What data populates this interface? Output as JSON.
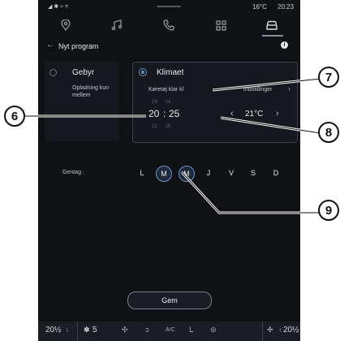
{
  "status_bar": {
    "temperature": "16°C",
    "time": "20:23"
  },
  "nav_tabs": [
    {
      "name": "location",
      "icon": "location-pin-icon"
    },
    {
      "name": "music",
      "icon": "music-note-icon"
    },
    {
      "name": "phone",
      "icon": "phone-icon"
    },
    {
      "name": "apps",
      "icon": "grid-icon"
    },
    {
      "name": "vehicle",
      "icon": "car-icon"
    }
  ],
  "header": {
    "title": "Nyt program"
  },
  "left_panel": {
    "option_label": "Gebyr",
    "description": "Opladning kun mellem"
  },
  "right_panel": {
    "option_label": "Klimaet",
    "ready_label": "Køretøj klar kl",
    "settings_label": "Indstillinger",
    "time_prev": "19      24",
    "time_hour": "20",
    "time_sep": ":",
    "time_minute": "25",
    "time_next": "21      26",
    "temperature": "21°C"
  },
  "repeat": {
    "label": "Gentag :",
    "days": [
      {
        "letter": "L",
        "selected": false
      },
      {
        "letter": "M",
        "selected": true
      },
      {
        "letter": "M",
        "selected": true
      },
      {
        "letter": "J",
        "selected": false
      },
      {
        "letter": "V",
        "selected": false
      },
      {
        "letter": "S",
        "selected": false
      },
      {
        "letter": "D",
        "selected": false
      }
    ]
  },
  "save_button": {
    "label": "Gem"
  },
  "bottom_bar": {
    "left_temp": "20½",
    "fan_level": "5",
    "ac_label": "A/C",
    "right_temp": "20½"
  },
  "callouts": [
    "6",
    "7",
    "8",
    "9"
  ],
  "colors": {
    "accent": "#6b93c9",
    "background": "#0f1114"
  }
}
